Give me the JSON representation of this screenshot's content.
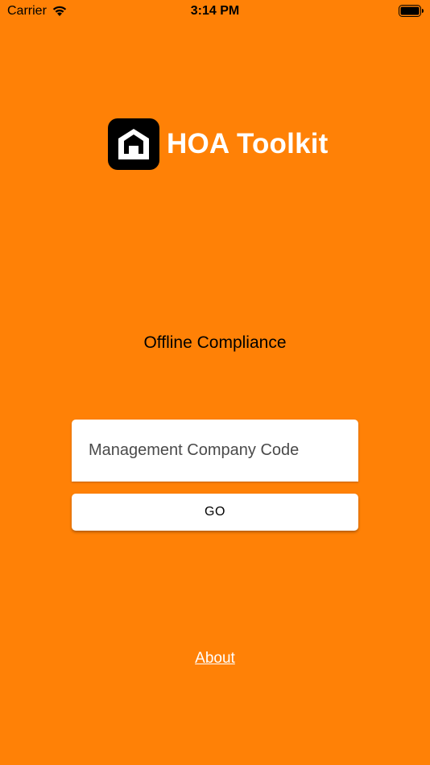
{
  "status_bar": {
    "carrier": "Carrier",
    "time": "3:14 PM",
    "icons": [
      "wifi-icon",
      "battery-icon"
    ]
  },
  "header": {
    "app_name": "HOA Toolkit",
    "logo_icon": "house-logo-icon"
  },
  "main": {
    "subtitle": "Offline Compliance",
    "code_input": {
      "placeholder": "Management Company Code",
      "value": ""
    },
    "go_label": "GO"
  },
  "footer": {
    "about_label": "About"
  },
  "colors": {
    "background": "#FF8106",
    "logo_bg": "#000000",
    "text_light": "#FFFFFF"
  }
}
